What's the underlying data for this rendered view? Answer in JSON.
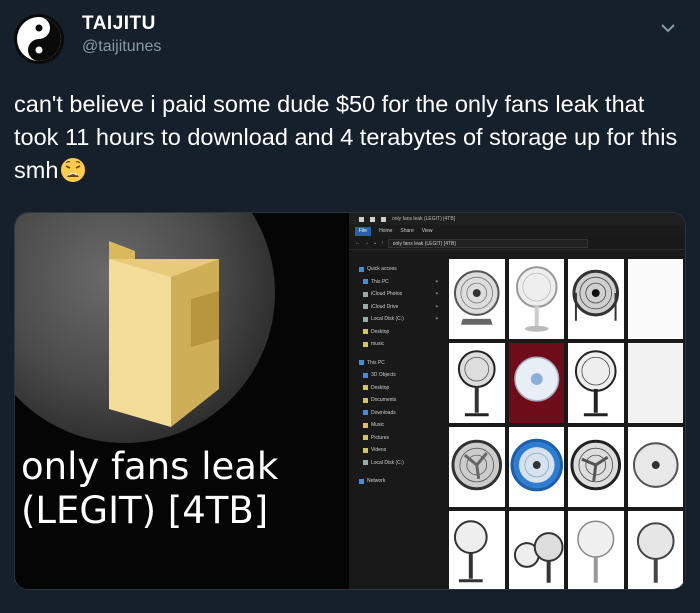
{
  "tweet": {
    "author_name": "TAIJITU",
    "author_handle": "@taijitunes",
    "text": "can't believe i paid some dude $50 for the only fans leak that took 11 hours to download and 4 terabytes of storage up for this smh",
    "emoji": "weary-face"
  },
  "media": {
    "folder_label_line1": "only fans leak",
    "folder_label_line2": "(LEGIT) [4TB]",
    "explorer": {
      "window_title": "only fans leak (LEGIT) [4TB]",
      "ribbon_tabs": [
        "File",
        "Home",
        "Share",
        "View"
      ],
      "address": "only fans leak (LEGIT) [4TB]",
      "nav_items": [
        {
          "label": "Quick access",
          "icon": "star-icon"
        },
        {
          "label": "This PC",
          "icon": "pc-icon"
        },
        {
          "label": "iCloud Photos",
          "icon": "cloud-icon"
        },
        {
          "label": "iCloud Drive",
          "icon": "cloud-icon"
        },
        {
          "label": "Local Disk (C:)",
          "icon": "disk-icon"
        },
        {
          "label": "Desktop",
          "icon": "folder-icon"
        },
        {
          "label": "music",
          "icon": "folder-icon"
        },
        {
          "label": "This PC",
          "icon": "pc-icon"
        },
        {
          "label": "3D Objects",
          "icon": "folder-icon"
        },
        {
          "label": "Desktop",
          "icon": "folder-icon"
        },
        {
          "label": "Documents",
          "icon": "folder-icon"
        },
        {
          "label": "Downloads",
          "icon": "folder-icon"
        },
        {
          "label": "Music",
          "icon": "folder-icon"
        },
        {
          "label": "Pictures",
          "icon": "folder-icon"
        },
        {
          "label": "Videos",
          "icon": "folder-icon"
        },
        {
          "label": "Local Disk (C:)",
          "icon": "disk-icon"
        },
        {
          "label": "Network",
          "icon": "network-icon"
        }
      ]
    }
  }
}
